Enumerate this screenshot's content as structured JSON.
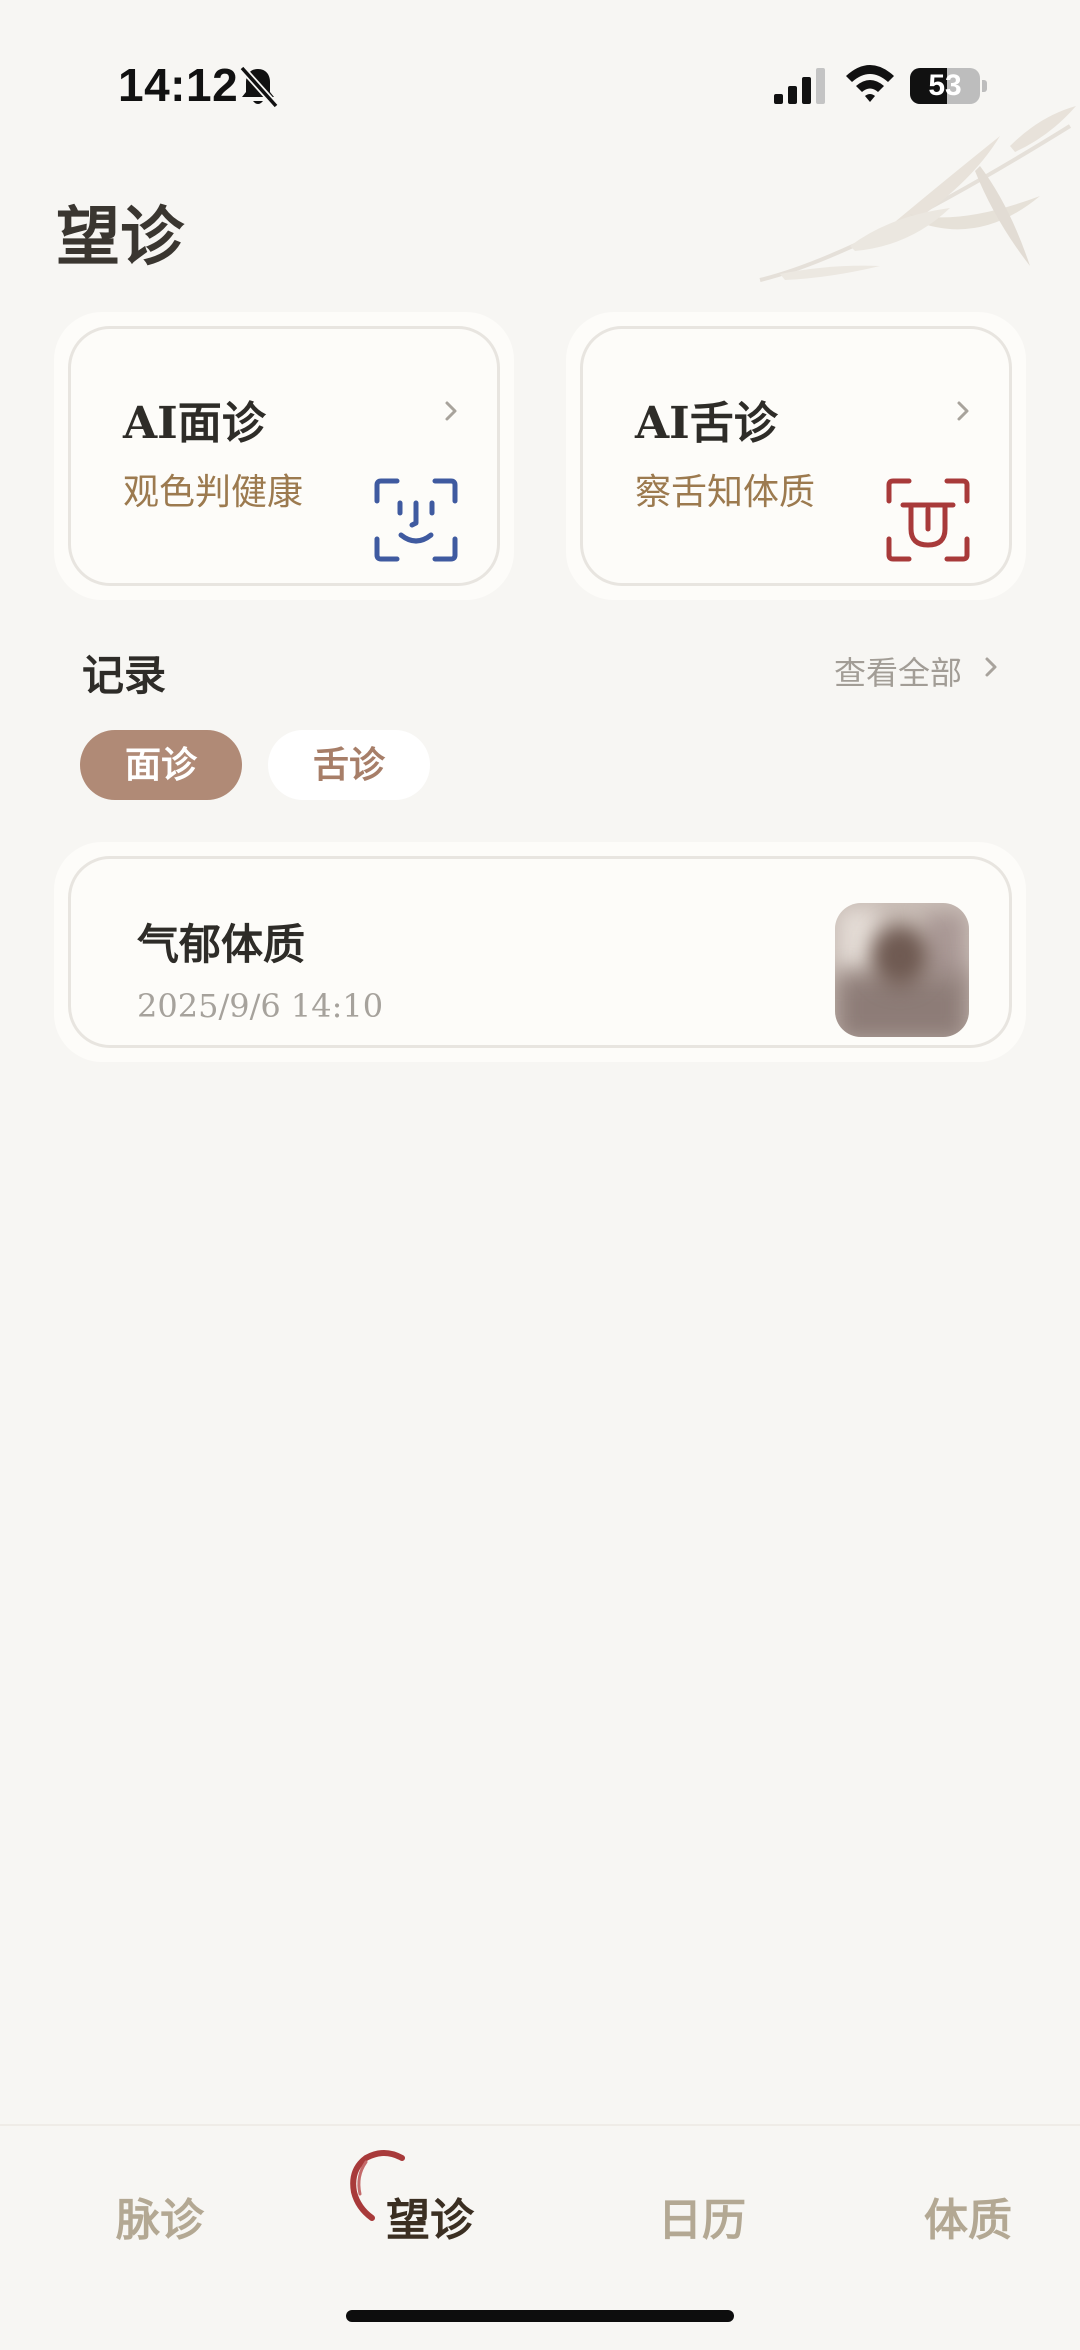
{
  "status_bar": {
    "time": "14:12",
    "battery": "53",
    "battery_level": 0.53
  },
  "page": {
    "title": "望诊"
  },
  "features": [
    {
      "title": "AI面诊",
      "subtitle": "观色判健康",
      "icon": "face-scan-icon",
      "icon_color": "#3f5aa0"
    },
    {
      "title": "AI舌诊",
      "subtitle": "察舌知体质",
      "icon": "tongue-scan-icon",
      "icon_color": "#a83a3a"
    }
  ],
  "records": {
    "title": "记录",
    "view_all": "查看全部",
    "tabs": [
      {
        "label": "面诊",
        "active": true
      },
      {
        "label": "舌诊",
        "active": false
      }
    ],
    "items": [
      {
        "title": "气郁体质",
        "date": "2025/9/6 14:10"
      }
    ]
  },
  "bottom_nav": {
    "items": [
      {
        "label": "脉诊",
        "active": false
      },
      {
        "label": "望诊",
        "active": true
      },
      {
        "label": "日历",
        "active": false
      },
      {
        "label": "体质",
        "active": false
      }
    ]
  },
  "colors": {
    "accent": "#b08a76",
    "subtitle": "#9c7a4f",
    "background": "#f7f6f3"
  }
}
